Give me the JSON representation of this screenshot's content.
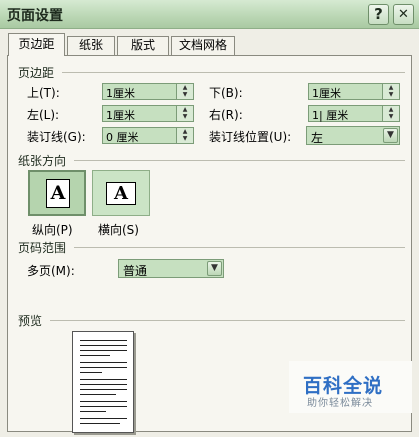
{
  "window": {
    "title": "页面设置",
    "help_button": "?",
    "close_button": "✕"
  },
  "tabs": [
    {
      "label": "页边距"
    },
    {
      "label": "纸张"
    },
    {
      "label": "版式"
    },
    {
      "label": "文档网格"
    }
  ],
  "margins": {
    "section_label": "页边距",
    "top": {
      "label": "上(T):",
      "value": "1厘米"
    },
    "bottom": {
      "label": "下(B):",
      "value": "1厘米"
    },
    "left": {
      "label": "左(L):",
      "value": "1厘米"
    },
    "right": {
      "label": "右(R):",
      "value": "1| 厘米"
    },
    "gutter": {
      "label": "装订线(G):",
      "value": "0 厘米"
    },
    "gutter_position": {
      "label": "装订线位置(U):",
      "value": "左"
    }
  },
  "orientation": {
    "section_label": "纸张方向",
    "portrait": {
      "label": "纵向(P)",
      "glyph": "A",
      "selected": true
    },
    "landscape": {
      "label": "横向(S)",
      "glyph": "A",
      "selected": false
    }
  },
  "pages": {
    "section_label": "页码范围",
    "multiple_label": "多页(M):",
    "multiple_value": "普通"
  },
  "preview": {
    "section_label": "预览"
  },
  "watermark": {
    "title": "百科全说",
    "subtitle": "助你轻松解决"
  },
  "colors": {
    "title_bar": "#bcd8b6",
    "control_fill": "#c6e0c0",
    "panel": "#f7f6f0",
    "watermark_blue": "#2f6fc4"
  },
  "icons": [
    "help-icon",
    "close-icon",
    "spin-up-icon",
    "spin-down-icon",
    "dropdown-arrow-icon",
    "portrait-page-icon",
    "landscape-page-icon"
  ]
}
